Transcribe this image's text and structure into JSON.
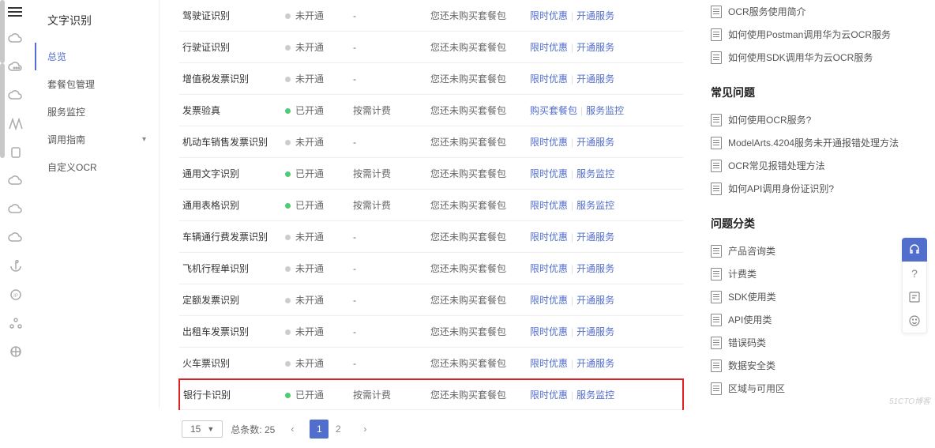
{
  "sidebar": {
    "title": "文字识别",
    "items": [
      {
        "label": "总览",
        "active": true
      },
      {
        "label": "套餐包管理",
        "active": false
      },
      {
        "label": "服务监控",
        "active": false
      },
      {
        "label": "调用指南",
        "active": false,
        "expandable": true
      },
      {
        "label": "自定义OCR",
        "active": false
      }
    ]
  },
  "status_labels": {
    "inactive": "未开通",
    "active": "已开通"
  },
  "billing_labels": {
    "none": "-",
    "pay": "按需计费"
  },
  "pkg_label": "您还未购买套餐包",
  "op_labels": {
    "promo": "限时优惠",
    "enable": "开通服务",
    "buy": "购买套餐包",
    "monitor": "服务监控"
  },
  "rows": [
    {
      "name": "驾驶证识别",
      "status": "inactive",
      "billing": "none",
      "ops": [
        "promo",
        "enable"
      ]
    },
    {
      "name": "行驶证识别",
      "status": "inactive",
      "billing": "none",
      "ops": [
        "promo",
        "enable"
      ]
    },
    {
      "name": "增值税发票识别",
      "status": "inactive",
      "billing": "none",
      "ops": [
        "promo",
        "enable"
      ]
    },
    {
      "name": "发票验真",
      "status": "active",
      "billing": "pay",
      "ops": [
        "buy",
        "monitor"
      ]
    },
    {
      "name": "机动车销售发票识别",
      "status": "inactive",
      "billing": "none",
      "ops": [
        "promo",
        "enable"
      ]
    },
    {
      "name": "通用文字识别",
      "status": "active",
      "billing": "pay",
      "ops": [
        "promo",
        "monitor"
      ]
    },
    {
      "name": "通用表格识别",
      "status": "active",
      "billing": "pay",
      "ops": [
        "promo",
        "monitor"
      ]
    },
    {
      "name": "车辆通行费发票识别",
      "status": "inactive",
      "billing": "none",
      "ops": [
        "promo",
        "enable"
      ]
    },
    {
      "name": "飞机行程单识别",
      "status": "inactive",
      "billing": "none",
      "ops": [
        "promo",
        "enable"
      ]
    },
    {
      "name": "定额发票识别",
      "status": "inactive",
      "billing": "none",
      "ops": [
        "promo",
        "enable"
      ]
    },
    {
      "name": "出租车发票识别",
      "status": "inactive",
      "billing": "none",
      "ops": [
        "promo",
        "enable"
      ]
    },
    {
      "name": "火车票识别",
      "status": "inactive",
      "billing": "none",
      "ops": [
        "promo",
        "enable"
      ]
    },
    {
      "name": "银行卡识别",
      "status": "active",
      "billing": "pay",
      "ops": [
        "promo",
        "monitor"
      ],
      "highlight": true
    }
  ],
  "pagination": {
    "page_size": "15",
    "total_label": "总条数:",
    "total": "25",
    "pages": [
      "1",
      "2"
    ],
    "current": "1"
  },
  "right": {
    "top_docs": [
      "OCR服务使用简介",
      "如何使用Postman调用华为云OCR服务",
      "如何使用SDK调用华为云OCR服务"
    ],
    "faq_title": "常见问题",
    "faq": [
      "如何使用OCR服务?",
      "ModelArts.4204服务未开通报错处理方法",
      "OCR常见报错处理方法",
      "如何API调用身份证识别?"
    ],
    "cat_title": "问题分类",
    "cats": [
      "产品咨询类",
      "计费类",
      "SDK使用类",
      "API使用类",
      "错误码类",
      "数据安全类",
      "区域与可用区"
    ]
  },
  "watermark": "51CTO博客"
}
